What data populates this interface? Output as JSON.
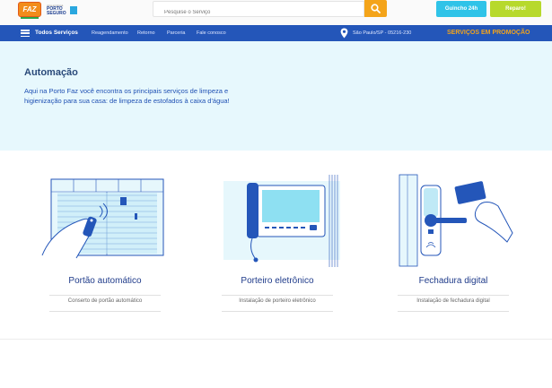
{
  "header": {
    "logo_text": "FAZ",
    "partner_small": "uma empresa",
    "partner_brand": "PORTO SEGURO",
    "search_placeholder": "Pesquise o Serviço",
    "quincho_label": "Guincho 24h",
    "reparo_label": "Reparo!"
  },
  "nav": {
    "all_services": "Todos Serviços",
    "links": [
      "Reagendamento",
      "Retorno",
      "Parceria",
      "Fale conosco"
    ],
    "location": "São Paulo/SP - 05216-230",
    "promo": "SERVIÇOS EM PROMOÇÃO"
  },
  "hero": {
    "title": "Automação",
    "description": "Aqui na Porto Faz você encontra os principais serviços de limpeza e higienização para sua casa: de limpeza de estofados à caixa d'água!"
  },
  "cards": [
    {
      "title": "Portão automático",
      "subtitle": "Conserto de portão automático",
      "icon": "gate-remote-icon"
    },
    {
      "title": "Porteiro eletrônico",
      "subtitle": "Instalação de porteiro eletrônico",
      "icon": "intercom-icon"
    },
    {
      "title": "Fechadura digital",
      "subtitle": "Instalação de fechadura digital",
      "icon": "digital-lock-icon"
    }
  ],
  "colors": {
    "nav": "#2456b9",
    "hero_bg": "#e7f8fd",
    "accent_orange": "#f4a41a",
    "quincho": "#2fc3e8",
    "reparo": "#b7d92c"
  }
}
